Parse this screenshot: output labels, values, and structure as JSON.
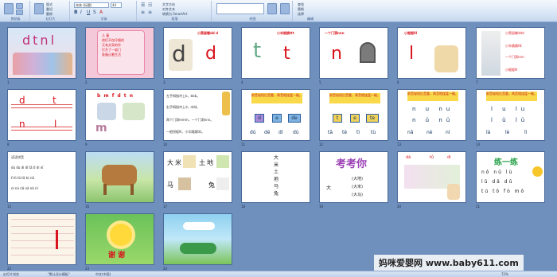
{
  "ribbon": {
    "groups": [
      "剪贴板",
      "幻灯片",
      "字体",
      "段落",
      "绘图",
      "编辑"
    ],
    "font_name": "宋体 (标题)",
    "font_size": "44",
    "items": [
      "新建",
      "版式",
      "重设",
      "删除",
      "幻灯片",
      "文字方向",
      "对齐文本",
      "转换为 SmartArt",
      "查找",
      "替换",
      "选择"
    ]
  },
  "slides": [
    {
      "n": "1",
      "title": "dtnl"
    },
    {
      "n": "2",
      "lines": [
        "儿 童",
        "他们不仅仔细的",
        "又有文采的作",
        "打开了一扇门",
        "准备过着生活"
      ]
    },
    {
      "n": "3",
      "label": "小黑鼠嘟dd d",
      "big": [
        "d",
        "d"
      ]
    },
    {
      "n": "4",
      "label": "小伞跳跳ttt",
      "big": [
        "t",
        "t"
      ]
    },
    {
      "n": "5",
      "label": "一个门洞nnn",
      "big": [
        "n"
      ]
    },
    {
      "n": "6",
      "label": "小棍棍lll",
      "big": [
        "l"
      ]
    },
    {
      "n": "7",
      "items": [
        "小黑鼠嘟ddd",
        "小伞跳跳ttt",
        "一个门洞nnn",
        "小棍棍lll"
      ]
    },
    {
      "n": "8",
      "letters": [
        "d",
        "t",
        "n",
        "l"
      ]
    },
    {
      "n": "9",
      "letters": [
        "b m f d t n"
      ]
    },
    {
      "n": "10",
      "lines": [
        "左手拇指冲上b，bbb。",
        "右手拇指冲上d，ddd。",
        "两个门洞mmm，一个门洞nnn。",
        "一根拐棍lll，小伞跳跳ttt。"
      ]
    },
    {
      "n": "11",
      "banner": "前音轻短后音重，两音相连猛一碰。",
      "boxes": [
        "d",
        "e",
        "de"
      ],
      "syll": [
        "dú",
        "dé",
        "dí",
        "dù"
      ]
    },
    {
      "n": "12",
      "banner": "前音轻短后音重，两音相连猛一碰。",
      "boxes": [
        "t",
        "e",
        "te"
      ],
      "syll": [
        "tā",
        "tè",
        "tì",
        "tù"
      ]
    },
    {
      "n": "13",
      "banner": "前音轻短后音重，两音相连猛一碰。",
      "rows": [
        "n u nu",
        "n ü nü"
      ],
      "syll": [
        "nǎ",
        "nè",
        "ní"
      ]
    },
    {
      "n": "14",
      "banner": "前音轻短后音重，两音相连猛一碰。",
      "rows": [
        "l u lu",
        "l ü lü"
      ],
      "syll": [
        "là",
        "lè",
        "lì"
      ]
    },
    {
      "n": "15",
      "heading": "读读拼音",
      "rows": [
        "dú dù dì dǐ tā tǐ dì nī",
        "tǐ tì tǔ tā tú nā",
        "ní nú nǎ ná ná nǐ"
      ]
    },
    {
      "n": "16"
    },
    {
      "n": "17",
      "chars": [
        "大",
        "米",
        "土",
        "地",
        "马",
        "兔"
      ]
    },
    {
      "n": "18",
      "chars": [
        "大",
        "米",
        "土",
        "地",
        "马",
        "兔"
      ]
    },
    {
      "n": "19",
      "title": "考考你",
      "opts": [
        "大地",
        "大米",
        "大马"
      ]
    },
    {
      "n": "20",
      "pinyin": [
        "dà",
        "tǔ",
        "dì"
      ]
    },
    {
      "n": "21",
      "title": "练一练",
      "rows": [
        "nǒ nǔ lù",
        "lǔ dǎ dǔ",
        "tú tǒ fò mǒ"
      ]
    },
    {
      "n": "22"
    },
    {
      "n": "23",
      "text": "谢 谢"
    },
    {
      "n": "24"
    }
  ],
  "status": {
    "slide_info": "幻灯片浏览",
    "theme": "\"默认设计模板\"",
    "lang": "中文(中国)",
    "zoom": "72%"
  },
  "watermark": "妈咪爱婴网 www.baby611.com"
}
